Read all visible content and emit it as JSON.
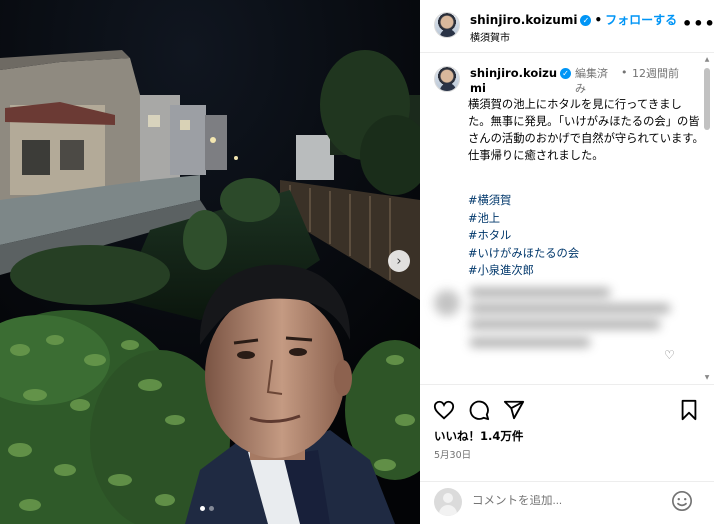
{
  "post": {
    "username": "shinjiro.koizumi",
    "follow_label": "フォローする",
    "location": "横須賀市",
    "more_label": "•••"
  },
  "caption": {
    "username": "shinjiro.koizumi",
    "edited_label": "編集済み",
    "separator": "•",
    "time_ago": "12週間前",
    "text": "横須賀の池上にホタルを見に行ってきました。無事に発見。「いけがみほたるの会」の皆さんの活動のおかげで自然が守られています。仕事帰りに癒されました。",
    "hashtags": [
      "#横須賀",
      "#池上",
      "#ホタル",
      "#いけがみほたるの会",
      "#小泉進次郎"
    ]
  },
  "stats": {
    "likes_label": "いいね！1.4万件",
    "date": "5月30日"
  },
  "comment": {
    "placeholder": "コメントを追加..."
  },
  "carousel": {
    "current": 1,
    "total": 2
  },
  "colors": {
    "accent": "#0095f6",
    "hashtag": "#00376b",
    "muted": "#737373"
  },
  "icons": [
    "verified-icon",
    "more-icon",
    "heart-icon",
    "comment-icon",
    "share-icon",
    "bookmark-icon",
    "emoji-icon",
    "next-arrow-icon"
  ]
}
